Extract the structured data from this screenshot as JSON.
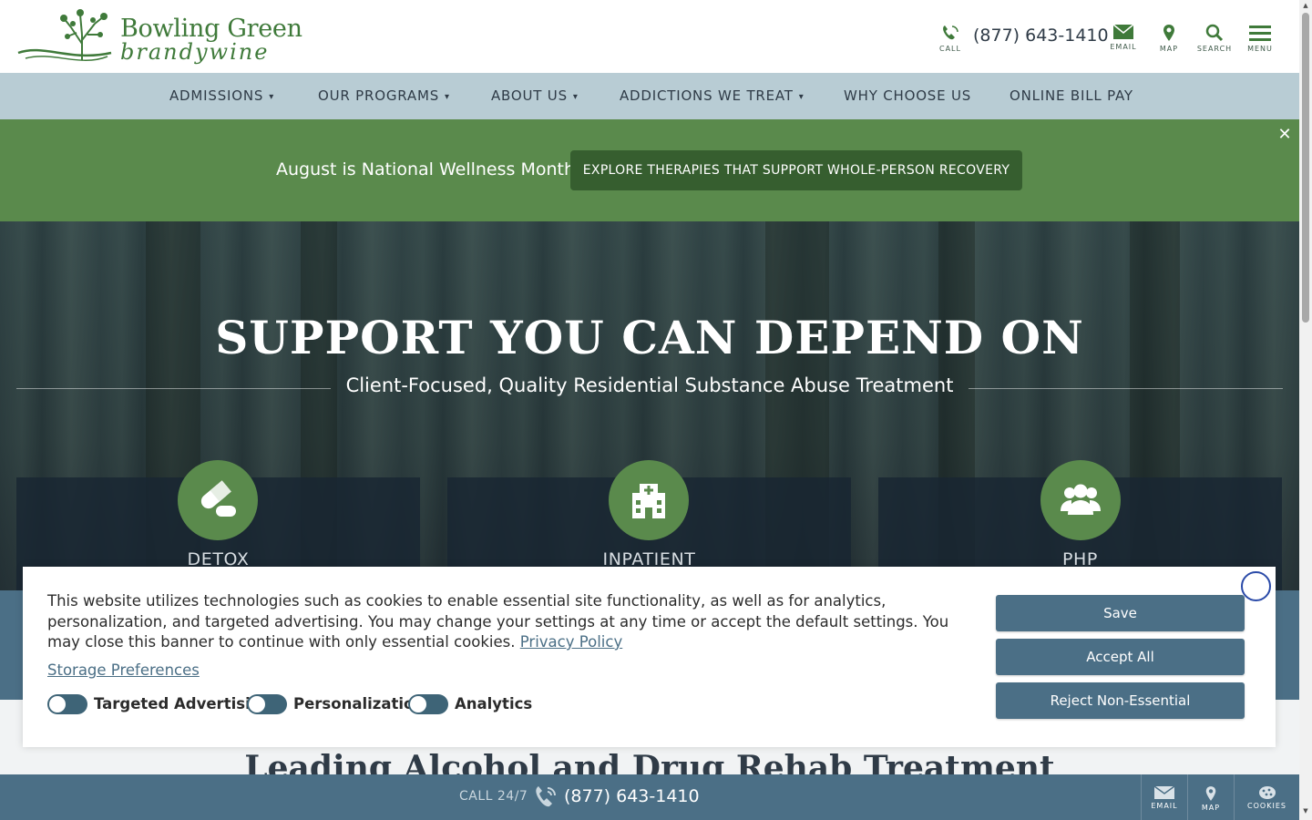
{
  "brand": {
    "name_line1": "Bowling Green",
    "name_line2": "brandywine",
    "color": "#3f7a3a"
  },
  "header": {
    "phone": "(877) 643-1410",
    "tools": {
      "call": "CALL",
      "email": "EMAIL",
      "map": "MAP",
      "search": "SEARCH",
      "menu": "MENU"
    }
  },
  "nav": {
    "items": [
      {
        "label": "ADMISSIONS",
        "caret": "▾"
      },
      {
        "label": "OUR PROGRAMS",
        "caret": "▾"
      },
      {
        "label": "ABOUT US",
        "caret": "▾"
      },
      {
        "label": "ADDICTIONS WE TREAT",
        "caret": "▾"
      },
      {
        "label": "WHY CHOOSE US",
        "caret": ""
      },
      {
        "label": "ONLINE BILL PAY",
        "caret": ""
      }
    ]
  },
  "promo": {
    "text": "August is National Wellness Month",
    "button": "EXPLORE THERAPIES THAT SUPPORT WHOLE-PERSON RECOVERY",
    "close": "✕",
    "color": "#5a8a4c"
  },
  "hero": {
    "title": "SUPPORT YOU CAN DEPEND ON",
    "subtitle": "Client-Focused, Quality Residential Substance Abuse Treatment",
    "cards": [
      {
        "label": "DETOX",
        "icon": "pills-icon"
      },
      {
        "label": "INPATIENT",
        "icon": "hospital-icon"
      },
      {
        "label": "PHP",
        "icon": "group-icon"
      }
    ]
  },
  "section2": {
    "title": "Leading Alcohol and Drug Rehab Treatment"
  },
  "cookie_banner": {
    "text": "This website utilizes technologies such as cookies to enable essential site functionality, as well as for analytics, personalization, and targeted advertising. You may change your settings at any time or accept the default settings. You may close this banner to continue with only essential cookies.",
    "privacy_link": "Privacy Policy",
    "storage_link": "Storage Preferences",
    "toggles": [
      {
        "label": "Targeted Advertising",
        "on": false
      },
      {
        "label": "Personalization",
        "on": false
      },
      {
        "label": "Analytics",
        "on": false
      }
    ],
    "buttons": {
      "save": "Save",
      "accept_all": "Accept All",
      "reject": "Reject Non-Essential"
    }
  },
  "bottom_bar": {
    "call_label": "CALL 24/7",
    "phone": "(877) 643-1410",
    "tools": {
      "email": "EMAIL",
      "map": "MAP",
      "cookies": "COOKIES"
    }
  },
  "colors": {
    "nav_bg": "#b8ccd4",
    "primary_blue": "#4b6f86",
    "green": "#5a8a4c",
    "dark_green": "#365e2f"
  }
}
